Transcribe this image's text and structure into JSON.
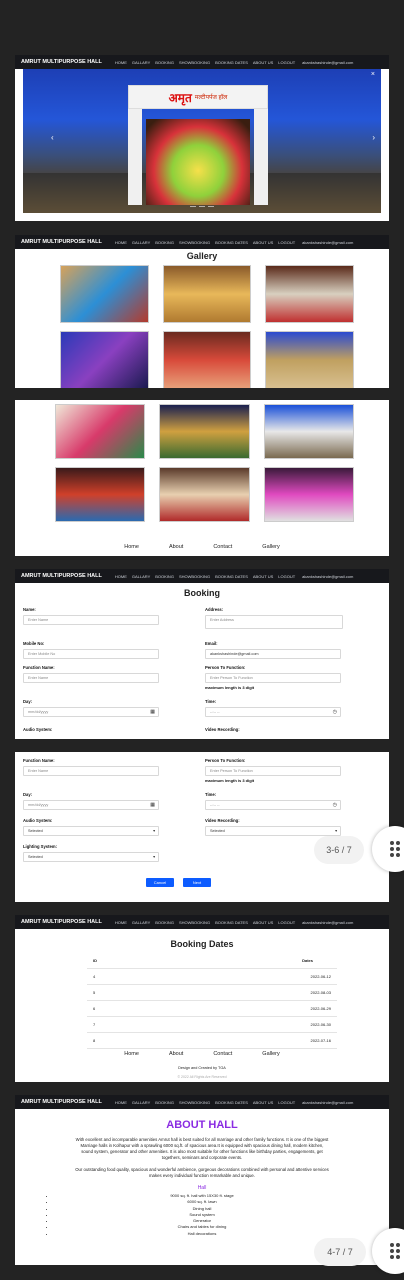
{
  "nav": {
    "brand": "AMRUT MULTIPURPOSE HALL",
    "items": [
      "HOME",
      "GALLARY",
      "BOOKING",
      "SHOWBOOKING",
      "BOOKING DATES",
      "ABOUT US",
      "LOGOUT"
    ],
    "email": "akankshashinde@gmail.com"
  },
  "hero": {
    "sign": "अमृत",
    "sign_sub": "मल्टीपर्पज हॉल",
    "prev": "‹",
    "next": "›",
    "close": "×"
  },
  "gallery": {
    "title": "Gallery"
  },
  "footer": {
    "links": [
      "Home",
      "About",
      "Contact",
      "Gallery"
    ],
    "credit": "Design and Created by TGA",
    "copyright": "© 2022 All Rights Are Reserved"
  },
  "booking": {
    "title": "Booking",
    "name": {
      "label": "Name:",
      "placeholder": "Enter Name"
    },
    "address": {
      "label": "Address:",
      "placeholder": "Enter Address"
    },
    "mobile": {
      "label": "Mobile No:",
      "placeholder": "Enter Mobile No"
    },
    "email": {
      "label": "Email:",
      "value": "akankshashinde@gmail.com"
    },
    "function_name": {
      "label": "Function Name:",
      "placeholder": "Enter Name"
    },
    "person": {
      "label": "Person To Function:",
      "placeholder": "Enter Person To Function",
      "note": "maximum length is 3 digit"
    },
    "day": {
      "label": "Day:",
      "placeholder": "mm/dd/yyyy"
    },
    "time": {
      "label": "Time:",
      "placeholder": "--:-- --"
    },
    "audio": {
      "label": "Audio System:",
      "value": "Selected"
    },
    "video": {
      "label": "Video Recording:",
      "value": "Selected"
    },
    "lighting": {
      "label": "Lighting System:",
      "value": "Selected"
    },
    "cancel": "Cancel",
    "next": "Next"
  },
  "booking_dates": {
    "title": "Booking Dates",
    "headers": [
      "ID",
      "Dates"
    ],
    "rows": [
      [
        "4",
        "2022-06-12"
      ],
      [
        "5",
        "2022-08-03"
      ],
      [
        "6",
        "2022-06-29"
      ],
      [
        "7",
        "2022-06-30"
      ],
      [
        "8",
        "2022-07-16"
      ]
    ]
  },
  "about": {
    "title": "ABOUT HALL",
    "p1": "With excellent and incomparable amenities Amrut hall is best suited for all marriage and other family functions. It is one of the biggest Marriage halls in Kolhapur with a sprawling 6000 sq.ft. of spacious area.It is equipped with spacious dining hall, modern kitchen, sound system, generator and other amenities. It is also most suitable for other functions like birthday parties, engagements, get togethers, seminars and corporate events.",
    "p2": "Our outstanding food quality, spacious and wonderful ambience, gorgeous decorations combined with personal and attentive services makes every individual function remarkable and unique.",
    "hall_label": "Hall",
    "features": [
      "9000 sq. ft. hall with 15X30 ft. stage",
      "6000 sq. ft. lawn",
      "Dining hall",
      "Sound system",
      "Generator",
      "Chairs and tables for dining",
      "Hall decorations"
    ]
  },
  "pager": {
    "first": "3-6 / 7",
    "second": "4-7 / 7"
  }
}
